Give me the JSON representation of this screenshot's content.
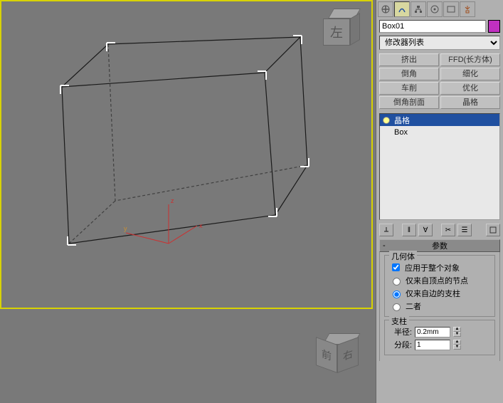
{
  "viewport": {
    "cube1_face": "左",
    "cube2_left": "前",
    "cube2_right": "右",
    "axis_x": "x",
    "axis_y": "y",
    "axis_z": "z"
  },
  "panel": {
    "object_name": "Box01",
    "modifier_list_label": "修改器列表",
    "mod_buttons": {
      "extrude": "挤出",
      "ffd_box": "FFD(长方体)",
      "chamfer": "倒角",
      "tessellate": "细化",
      "lathe": "车削",
      "optimize": "优化",
      "chamfer_section": "倒角剖面",
      "lattice": "晶格"
    },
    "stack": {
      "item_lattice": "晶格",
      "item_box": "Box"
    },
    "rollout_params": "参数",
    "geom_group": "几何体",
    "apply_whole": "应用于整个对象",
    "only_vertex": "仅来自顶点的节点",
    "only_edge": "仅来自边的支柱",
    "both": "二者",
    "struts_group": "支柱",
    "radius_label": "半径:",
    "radius_value": "0.2mm",
    "segs_label": "分段:",
    "segs_value": "1"
  },
  "colors": {
    "swatch": "#c030c0"
  }
}
